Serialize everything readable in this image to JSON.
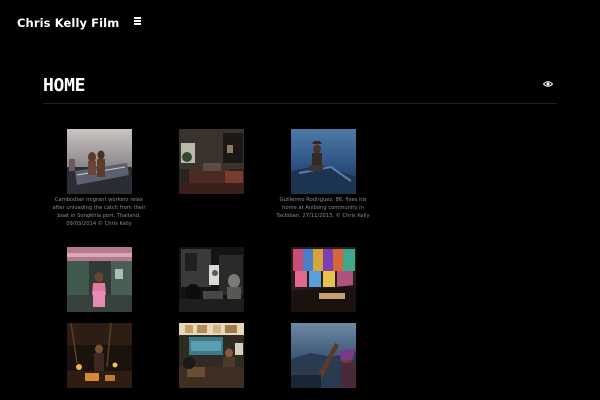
{
  "site": {
    "title": "Chris Kelly Film"
  },
  "page": {
    "heading": "HOME"
  },
  "icons": {
    "menu": "hamburger-menu-icon",
    "view": "eye-icon"
  },
  "gallery": {
    "captions": {
      "photo1": "Cambodian migrant workers relax after unloading the catch from their boat in Songkhla port, Thailand. 09/03/2014 © Chris Kelly",
      "photo3": "Guillermo Rodriguez, 86, fixes his home at Anibong community in Tacloban. 27/11/2013. © Chris Kelly"
    }
  }
}
